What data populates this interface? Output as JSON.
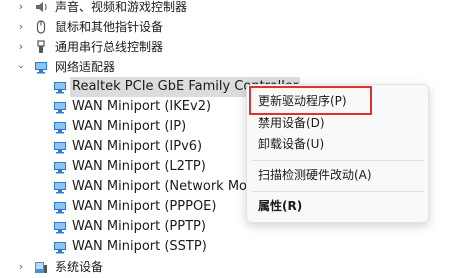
{
  "tree": {
    "categories_top": [
      {
        "label": "声音、视频和游戏控制器",
        "icon": "speaker-icon"
      },
      {
        "label": "鼠标和其他指针设备",
        "icon": "mouse-icon"
      },
      {
        "label": "通用串行总线控制器",
        "icon": "usb-icon"
      }
    ],
    "network_category": {
      "label": "网络适配器",
      "icon": "network-adapter-icon",
      "expanded": true
    },
    "adapters": [
      {
        "label": "Realtek PCIe GbE Family Controller",
        "selected": true
      },
      {
        "label": "WAN Miniport (IKEv2)"
      },
      {
        "label": "WAN Miniport (IP)"
      },
      {
        "label": "WAN Miniport (IPv6)"
      },
      {
        "label": "WAN Miniport (L2TP)"
      },
      {
        "label": "WAN Miniport (Network Monitor)"
      },
      {
        "label": "WAN Miniport (PPPOE)"
      },
      {
        "label": "WAN Miniport (PPTP)"
      },
      {
        "label": "WAN Miniport (SSTP)"
      }
    ],
    "categories_bottom": [
      {
        "label": "系统设备",
        "icon": "system-device-icon"
      }
    ]
  },
  "context_menu": {
    "items": [
      {
        "label": "更新驱动程序(P)",
        "highlighted": true
      },
      {
        "label": "禁用设备(D)"
      },
      {
        "label": "卸载设备(U)"
      },
      {
        "label": "扫描检测硬件改动(A)"
      },
      {
        "label": "属性(R)",
        "bold": true
      }
    ]
  },
  "colors": {
    "highlight_border": "#e03030",
    "selection": "#dcdcdc",
    "network_icon": "#2b7cd3"
  }
}
